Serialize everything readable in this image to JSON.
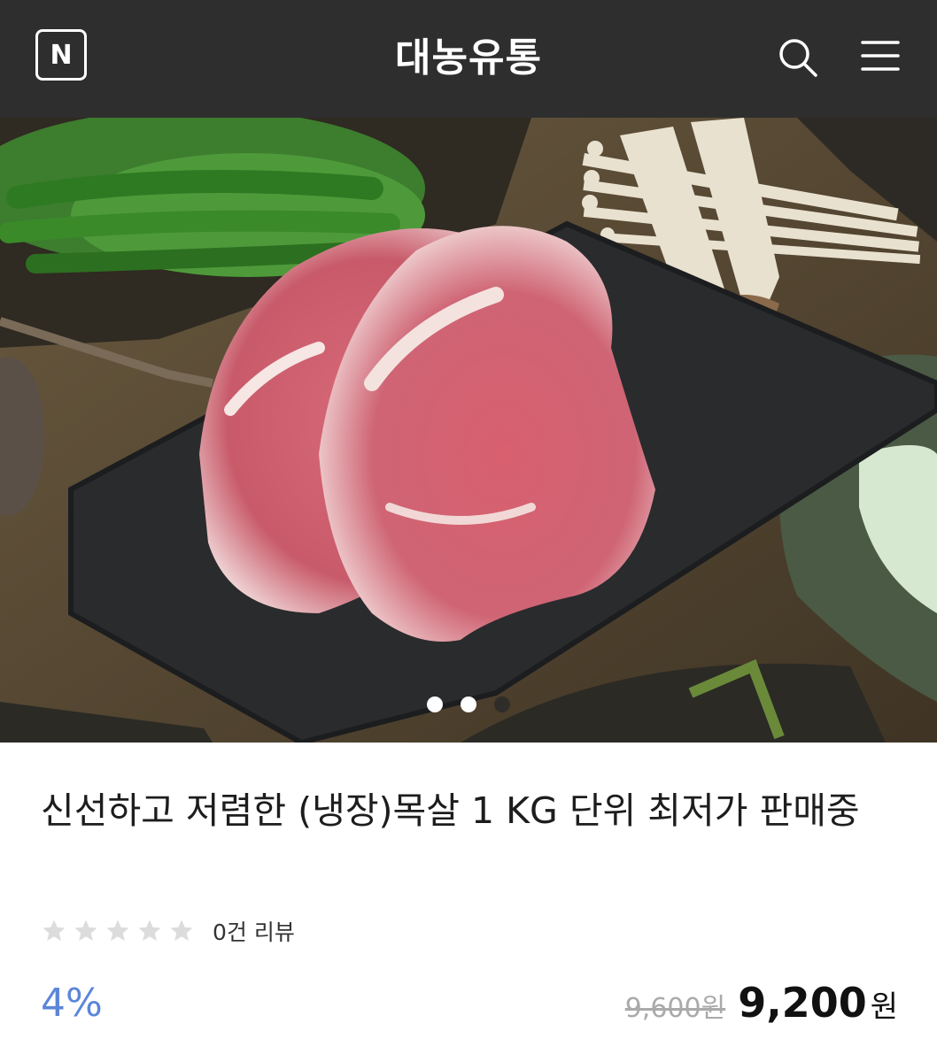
{
  "header": {
    "logo_letter": "N",
    "store_name": "대농유통",
    "icons": [
      "search-icon",
      "menu-icon"
    ],
    "background": "#2e2e2e"
  },
  "gallery": {
    "total_images": 3,
    "active_index": 1
  },
  "product": {
    "title": "신선하고 저렴한 (냉장)목살 1 KG 단위 최저가 판매중",
    "rating": 0,
    "rating_max": 5,
    "review_text": "0건 리뷰",
    "discount": "4%",
    "original_price": "9,600원",
    "sale_price": "9,200",
    "currency": "원",
    "accent_color": "#5b86d9"
  }
}
